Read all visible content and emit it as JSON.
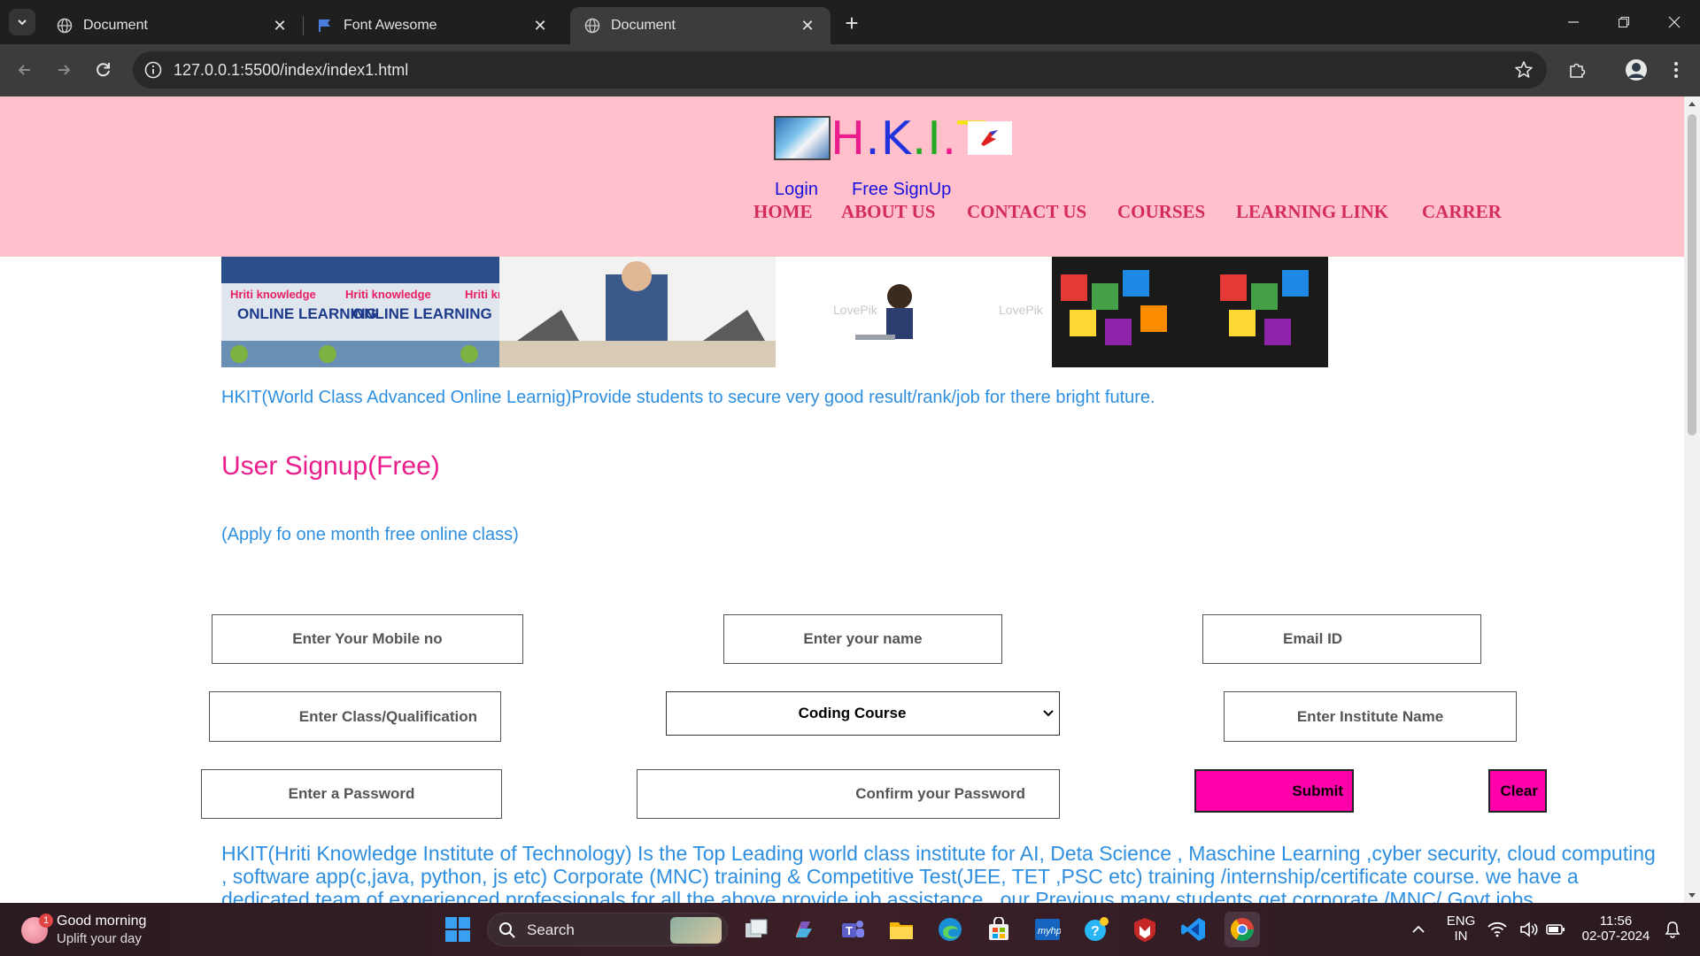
{
  "browser": {
    "tabs": [
      {
        "title": "Document",
        "icon": "globe-icon",
        "active": false
      },
      {
        "title": "Font Awesome",
        "icon": "flag-icon",
        "active": false
      },
      {
        "title": "Document",
        "icon": "globe-icon",
        "active": true
      }
    ],
    "url": "127.0.0.1:5500/index/index1.html"
  },
  "header": {
    "logo_letters": [
      "H",
      ".K",
      ".I",
      ".",
      "T"
    ],
    "auth_links": {
      "login": "Login",
      "signup": "Free SignUp"
    },
    "nav": [
      "HOME",
      "ABOUT US",
      "CONTACT US",
      "COURSES",
      "LEARNING LINK",
      "CARRER"
    ]
  },
  "banner": {
    "images": [
      "online-learning-banner",
      "student-with-laptop",
      "child-with-laptop",
      "programming-cubes"
    ],
    "overlay_text": {
      "brand": "Hriti knowledge",
      "headline": "ONLINE LEARNING",
      "watermark": "LovePik"
    }
  },
  "intro": "HKIT(World Class Advanced Online Learnig)Provide students to secure very good result/rank/job for there bright future.",
  "signup": {
    "title": "User Signup(Free)",
    "subtitle": "(Apply fo one month free online class)",
    "fields": {
      "mobile": "Enter Your Mobile no",
      "name": "Enter your name",
      "email": "Email ID",
      "qualification": "Enter Class/Qualification",
      "course": "Coding Course",
      "institute": "Enter Institute Name",
      "password": "Enter a Password",
      "confirm": "Confirm your Password"
    },
    "submit": "Submit",
    "clear": "Clear"
  },
  "about": "HKIT(Hriti Knowledge Institute of Technology) Is the Top Leading world class institute for AI, Deta Science , Maschine Learning ,cyber security, cloud computing , software app(c,java, python, js etc) Corporate (MNC) training & Competitive Test(JEE, TET ,PSC etc) training /internship/certificate course. we have a dedicated team of experienced professionals for all the above provide job assistance , our Previous many students get corporate /MNC/ Govt jobs",
  "taskbar": {
    "weather": {
      "line1": "Good morning",
      "line2": "Uplift your day",
      "badge": "1"
    },
    "search_label": "Search",
    "lang": {
      "line1": "ENG",
      "line2": "IN"
    },
    "clock": {
      "time": "11:56",
      "date": "02-07-2024"
    }
  },
  "colors": {
    "header_bg": "#ffc0cb",
    "nav": "#d42d5c",
    "link": "#1a10e0",
    "accent_pink": "#e91e8c",
    "text_blue": "#2e8fe0",
    "submit_bg": "#ff00aa"
  }
}
